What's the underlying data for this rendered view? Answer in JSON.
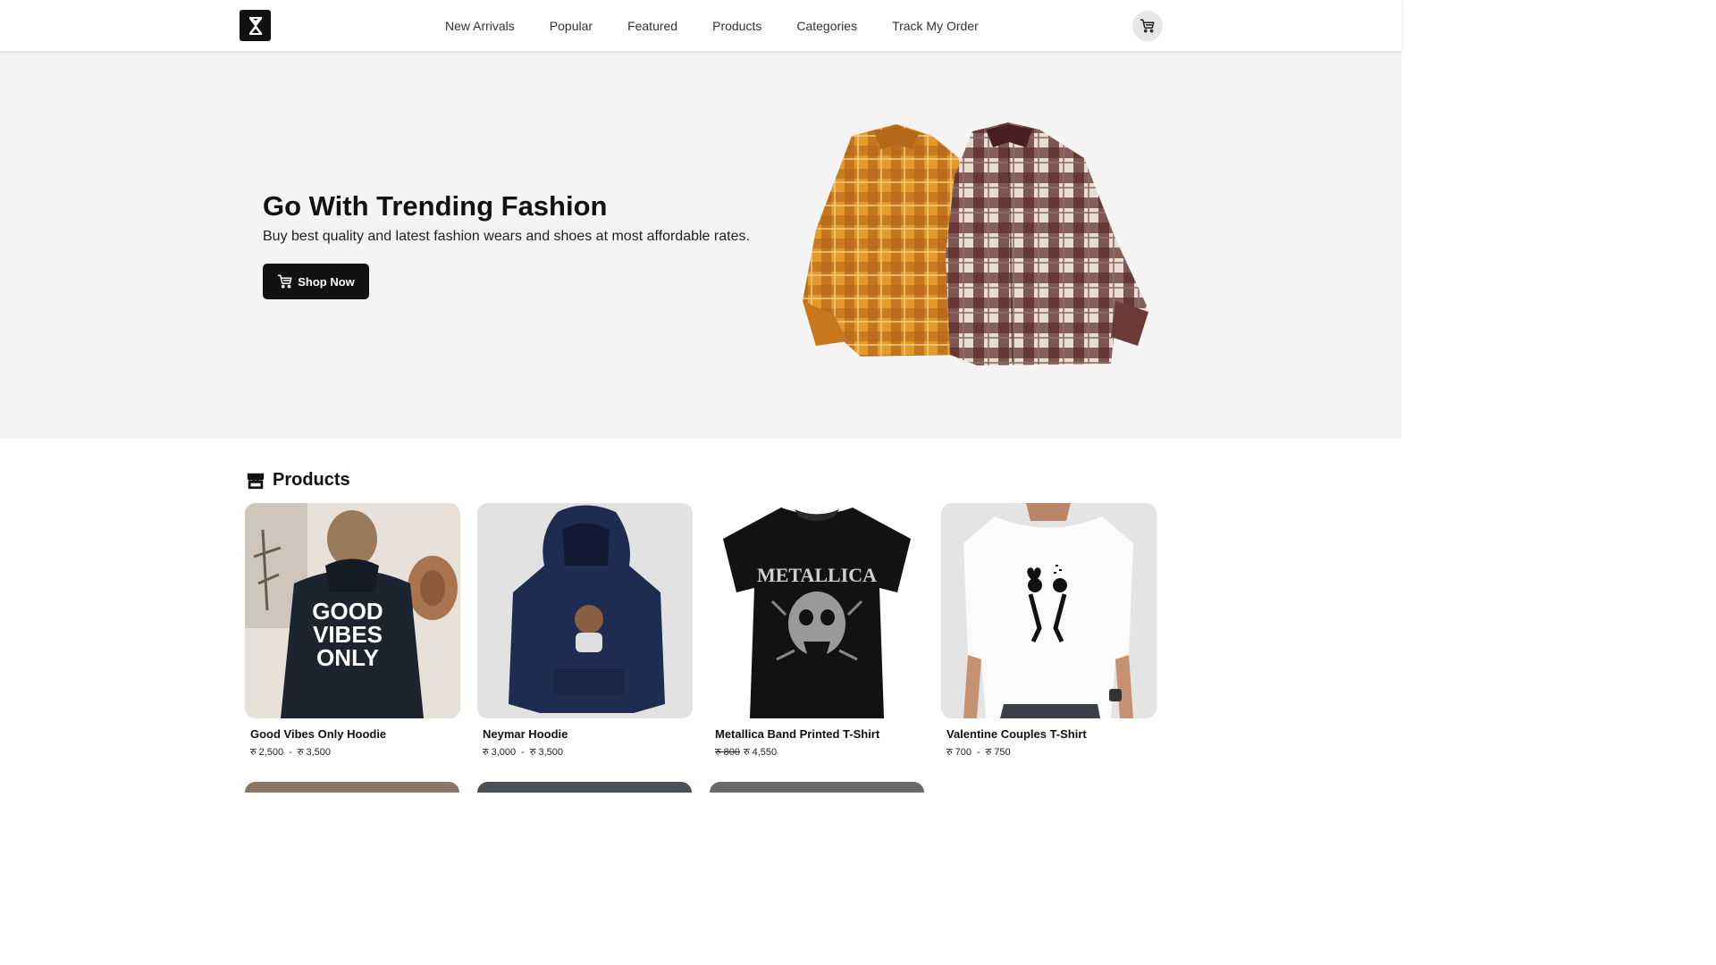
{
  "header": {
    "logo_icon": "hourglass-logo-icon",
    "nav": [
      "New Arrivals",
      "Popular",
      "Featured",
      "Products",
      "Categories",
      "Track My Order"
    ],
    "cart_icon": "cart-icon"
  },
  "hero": {
    "title": "Go With Trending Fashion",
    "subtitle": "Buy best quality and latest fashion wears and shoes at most affordable rates.",
    "button_label": "Shop Now",
    "button_icon": "cart-icon",
    "image": "plaid-shirts-image"
  },
  "products_section": {
    "title": "Products",
    "icon": "store-icon",
    "items": [
      {
        "name": "Good Vibes Only Hoodie",
        "price_from": "रु 2,500",
        "separator": "-",
        "price_to": "रु 3,500",
        "print_lines": [
          "GOOD",
          "VIBES",
          "ONLY"
        ]
      },
      {
        "name": "Neymar Hoodie",
        "price_from": "रु 3,000",
        "separator": "-",
        "price_to": "रु 3,500"
      },
      {
        "name": "Metallica Band Printed T-Shirt",
        "old_price": "रु 800",
        "price": "रु 4,550",
        "print_text": "METALLICA"
      },
      {
        "name": "Valentine Couples T-Shirt",
        "price_from": "रु 700",
        "separator": "-",
        "price_to": "रु 750"
      }
    ]
  },
  "colors": {
    "dark": "#111111",
    "hero_bg": "#f4f4f4",
    "cart_bg": "#e6e6e6"
  }
}
